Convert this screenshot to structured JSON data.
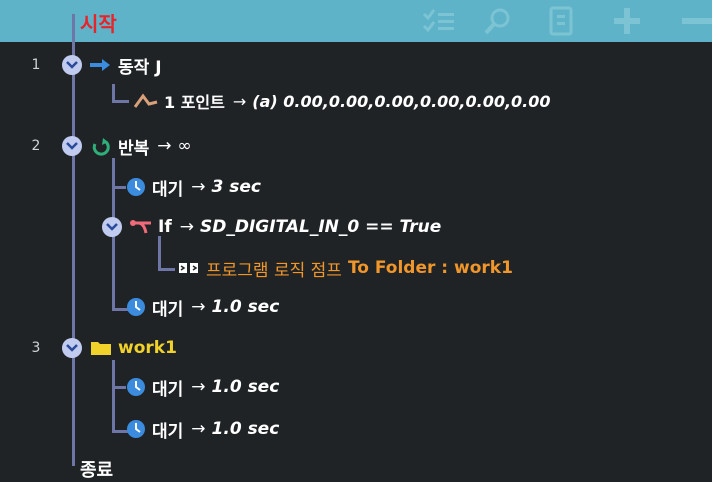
{
  "tree": {
    "start_label": "시작",
    "end_label": "종료",
    "items": [
      {
        "num": "1",
        "label": "동작 J",
        "icon": "arrow-right-icon"
      },
      {
        "label": "1 포인트",
        "arrow": "→",
        "param": "(a) 0.00,0.00,0.00,0.00,0.00,0.00",
        "icon": "waypoint-icon"
      },
      {
        "num": "2",
        "label": "반복",
        "arrow": "→",
        "param": "∞",
        "icon": "loop-icon"
      },
      {
        "label": "대기",
        "arrow": "→",
        "param": "3 sec",
        "icon": "clock-icon"
      },
      {
        "label": "If",
        "arrow": "→",
        "param": "SD_DIGITAL_IN_0 == True",
        "icon": "branch-icon"
      },
      {
        "label": "프로그램 로직 점프",
        "param": "To Folder : work1",
        "icon": "jump-icon"
      },
      {
        "label": "대기",
        "arrow": "→",
        "param": "1.0 sec",
        "icon": "clock-icon"
      },
      {
        "num": "3",
        "label": "work1",
        "icon": "folder-icon"
      },
      {
        "label": "대기",
        "arrow": "→",
        "param": "1.0 sec",
        "icon": "clock-icon"
      },
      {
        "label": "대기",
        "arrow": "→",
        "param": "1.0 sec",
        "icon": "clock-icon"
      }
    ]
  },
  "toolbar": {
    "icons": [
      "checklist-icon",
      "search-icon",
      "document-icon",
      "plus-icon",
      "minus-icon"
    ]
  },
  "colors": {
    "topbar": "#5fb3c8",
    "background": "#1f2326",
    "tree_line": "#6e76a8",
    "start_label": "#e8232a",
    "arrow_blue": "#3b8bdf",
    "loop_green": "#2fb07a",
    "branch_pink": "#f06a7a",
    "jump_orange": "#f0962a",
    "folder_yellow": "#f0d22a",
    "clock_blue": "#3b8bdf"
  }
}
